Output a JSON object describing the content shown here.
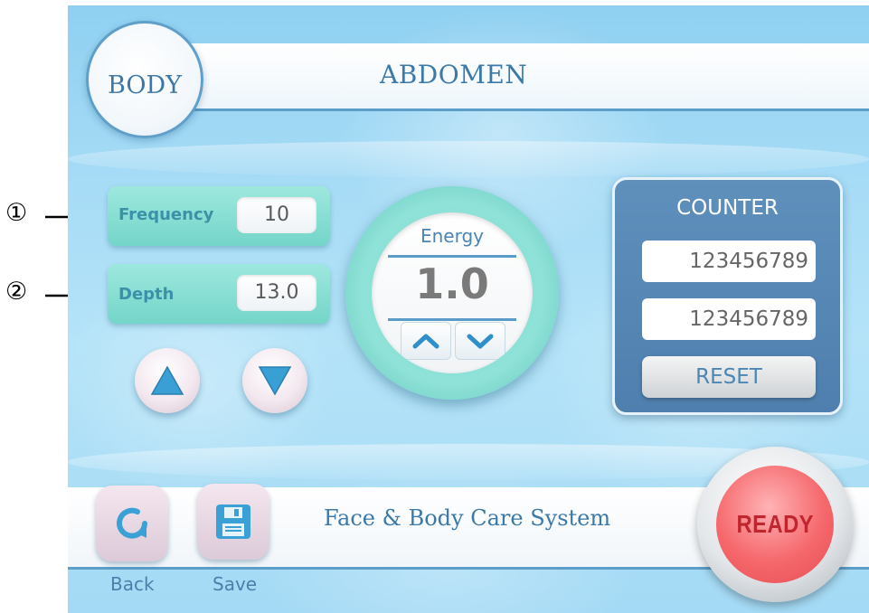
{
  "header": {
    "mode_label": "BODY",
    "title": "ABDOMEN"
  },
  "params": {
    "frequency": {
      "label": "Frequency",
      "value": "10"
    },
    "depth": {
      "label": "Depth",
      "value": "13.0"
    }
  },
  "callouts": {
    "first": "①",
    "second": "②"
  },
  "energy": {
    "label": "Energy",
    "value": "1.0"
  },
  "counter": {
    "title": "COUNTER",
    "value_1": "123456789",
    "value_2": "123456789",
    "reset_label": "RESET"
  },
  "footer": {
    "system_name": "Face & Body Care System",
    "back_label": "Back",
    "save_label": "Save"
  },
  "ready_button": {
    "label": "READY"
  },
  "colors": {
    "background": "#a7dcf6",
    "accent_text": "#3b79a8",
    "param_box": "#8ee0d6",
    "counter_panel": "#5585b3",
    "ready_red": "#f5686c"
  },
  "icons": {
    "up": "triangle-up-icon",
    "down": "triangle-down-icon",
    "energy_up": "chevron-up-icon",
    "energy_down": "chevron-down-icon",
    "back": "refresh-icon",
    "save": "floppy-disk-icon"
  }
}
